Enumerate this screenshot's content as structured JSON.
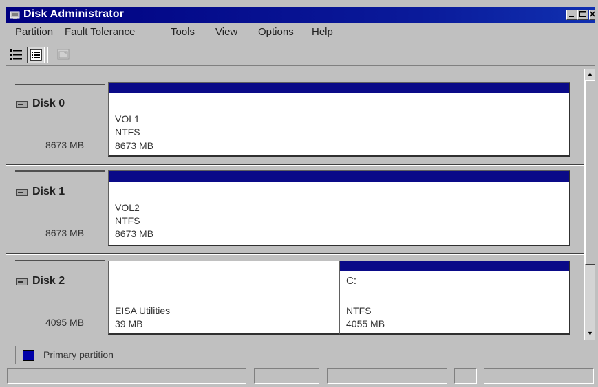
{
  "window": {
    "title": "Disk Administrator"
  },
  "menu": [
    {
      "label": "Partition",
      "accel": "P"
    },
    {
      "label": "Fault Tolerance",
      "accel": "F"
    },
    {
      "label": "Tools",
      "accel": "T"
    },
    {
      "label": "View",
      "accel": "V"
    },
    {
      "label": "Options",
      "accel": "O"
    },
    {
      "label": "Help",
      "accel": "H"
    }
  ],
  "toolbar": [
    "volumes-view-icon",
    "disk-configuration-view-icon",
    "properties-icon"
  ],
  "disks": [
    {
      "name": "Disk 0",
      "size": "8673 MB",
      "partitions": [
        {
          "drive": "",
          "label": "VOL1",
          "fs": "NTFS",
          "size": "8673 MB"
        }
      ]
    },
    {
      "name": "Disk 1",
      "size": "8673 MB",
      "partitions": [
        {
          "drive": "",
          "label": "VOL2",
          "fs": "NTFS",
          "size": "8673 MB"
        }
      ]
    },
    {
      "name": "Disk 2",
      "size": "4095 MB",
      "partitions": [
        {
          "drive": "",
          "label": "EISA Utilities",
          "fs": "",
          "size": "39 MB"
        },
        {
          "drive": "C:",
          "label": "",
          "fs": "NTFS",
          "size": "4055 MB"
        }
      ]
    }
  ],
  "legend": {
    "label": "Primary partition",
    "color": "#0000a8"
  },
  "status": {
    "panes": [
      "",
      "",
      "",
      "",
      ""
    ]
  },
  "colors": {
    "titlebar": "#000080",
    "partition_bar": "#0a0a88",
    "face": "#c0c0c0"
  }
}
